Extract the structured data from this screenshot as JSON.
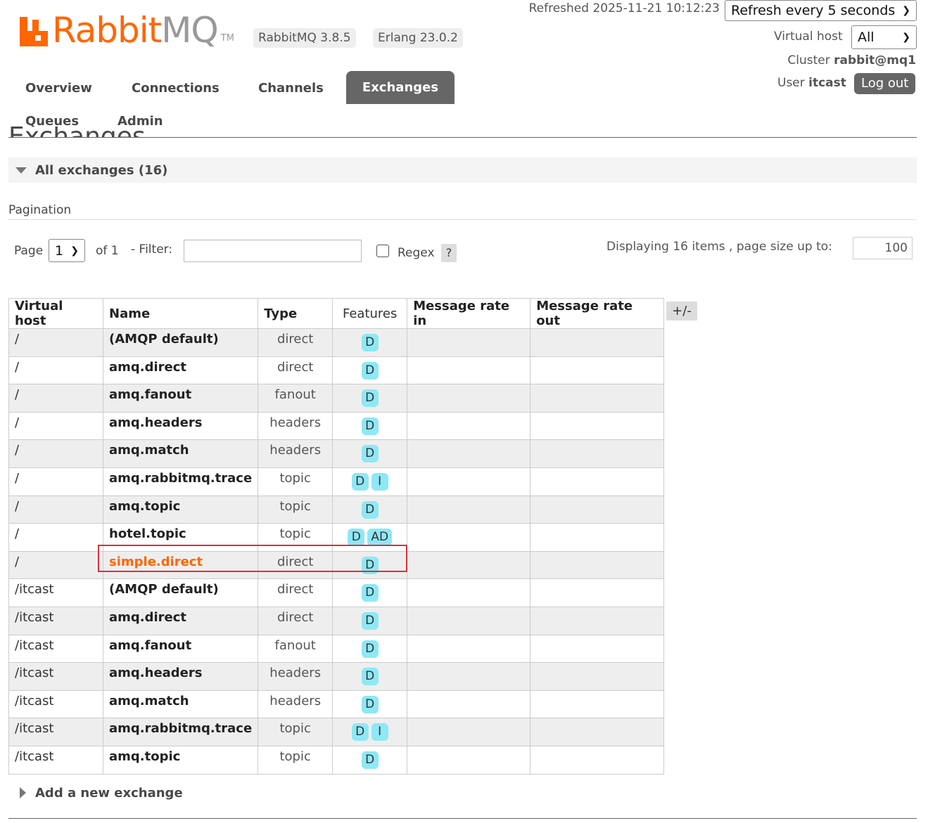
{
  "brand": {
    "name_orange": "Rabbit",
    "name_grey": "MQ",
    "tm": "TM",
    "version_badge": "RabbitMQ 3.8.5",
    "erlang_badge": "Erlang 23.0.2"
  },
  "header": {
    "refreshed": "Refreshed 2025-11-21 10:12:23",
    "refresh_option": "Refresh every 5 seconds",
    "virtual_host_label": "Virtual host",
    "virtual_host_value": "All",
    "cluster_label": "Cluster ",
    "cluster_value": "rabbit@mq1",
    "user_label": "User ",
    "user_value": "itcast",
    "logout_label": "Log out"
  },
  "nav": {
    "overview": "Overview",
    "connections": "Connections",
    "channels": "Channels",
    "exchanges": "Exchanges",
    "queues": "Queues",
    "admin": "Admin",
    "active": "exchanges"
  },
  "page": {
    "heading": "Exchanges",
    "section_title": "All exchanges (16)",
    "pagination_label": "Pagination",
    "page_label": "Page",
    "page_value": "1",
    "of_label": "of 1",
    "filter_label": "- Filter:",
    "filter_value": "",
    "regex_label": "Regex",
    "help_label": "?",
    "display_label": "Displaying 16 items , page size up to:",
    "page_size_value": "100",
    "columns_toggle": "+/-",
    "add_exchange_label": "Add a new exchange"
  },
  "table": {
    "headers": [
      "Virtual host",
      "Name",
      "Type",
      "Features",
      "Message rate in",
      "Message rate out"
    ],
    "rows": [
      {
        "vhost": "/",
        "name": "(AMQP default)",
        "type": "direct",
        "features": [
          "D"
        ]
      },
      {
        "vhost": "/",
        "name": "amq.direct",
        "type": "direct",
        "features": [
          "D"
        ]
      },
      {
        "vhost": "/",
        "name": "amq.fanout",
        "type": "fanout",
        "features": [
          "D"
        ]
      },
      {
        "vhost": "/",
        "name": "amq.headers",
        "type": "headers",
        "features": [
          "D"
        ]
      },
      {
        "vhost": "/",
        "name": "amq.match",
        "type": "headers",
        "features": [
          "D"
        ]
      },
      {
        "vhost": "/",
        "name": "amq.rabbitmq.trace",
        "type": "topic",
        "features": [
          "D",
          "I"
        ]
      },
      {
        "vhost": "/",
        "name": "amq.topic",
        "type": "topic",
        "features": [
          "D"
        ]
      },
      {
        "vhost": "/",
        "name": "hotel.topic",
        "type": "topic",
        "features": [
          "D",
          "AD"
        ]
      },
      {
        "vhost": "/",
        "name": "simple.direct",
        "type": "direct",
        "features": [
          "D"
        ],
        "highlighted": true
      },
      {
        "vhost": "/itcast",
        "name": "(AMQP default)",
        "type": "direct",
        "features": [
          "D"
        ]
      },
      {
        "vhost": "/itcast",
        "name": "amq.direct",
        "type": "direct",
        "features": [
          "D"
        ]
      },
      {
        "vhost": "/itcast",
        "name": "amq.fanout",
        "type": "fanout",
        "features": [
          "D"
        ]
      },
      {
        "vhost": "/itcast",
        "name": "amq.headers",
        "type": "headers",
        "features": [
          "D"
        ]
      },
      {
        "vhost": "/itcast",
        "name": "amq.match",
        "type": "headers",
        "features": [
          "D"
        ]
      },
      {
        "vhost": "/itcast",
        "name": "amq.rabbitmq.trace",
        "type": "topic",
        "features": [
          "D",
          "I"
        ]
      },
      {
        "vhost": "/itcast",
        "name": "amq.topic",
        "type": "topic",
        "features": [
          "D"
        ]
      }
    ]
  },
  "colors": {
    "brand_orange": "#ff6600",
    "nav_active": "#666666",
    "feature_badge": "#8ee8f5",
    "highlight_box": "#d9323a"
  },
  "icons": {
    "section_toggle": "triangle-down-icon",
    "add_toggle": "triangle-right-icon",
    "select_chevron": "chevron-down-icon"
  }
}
